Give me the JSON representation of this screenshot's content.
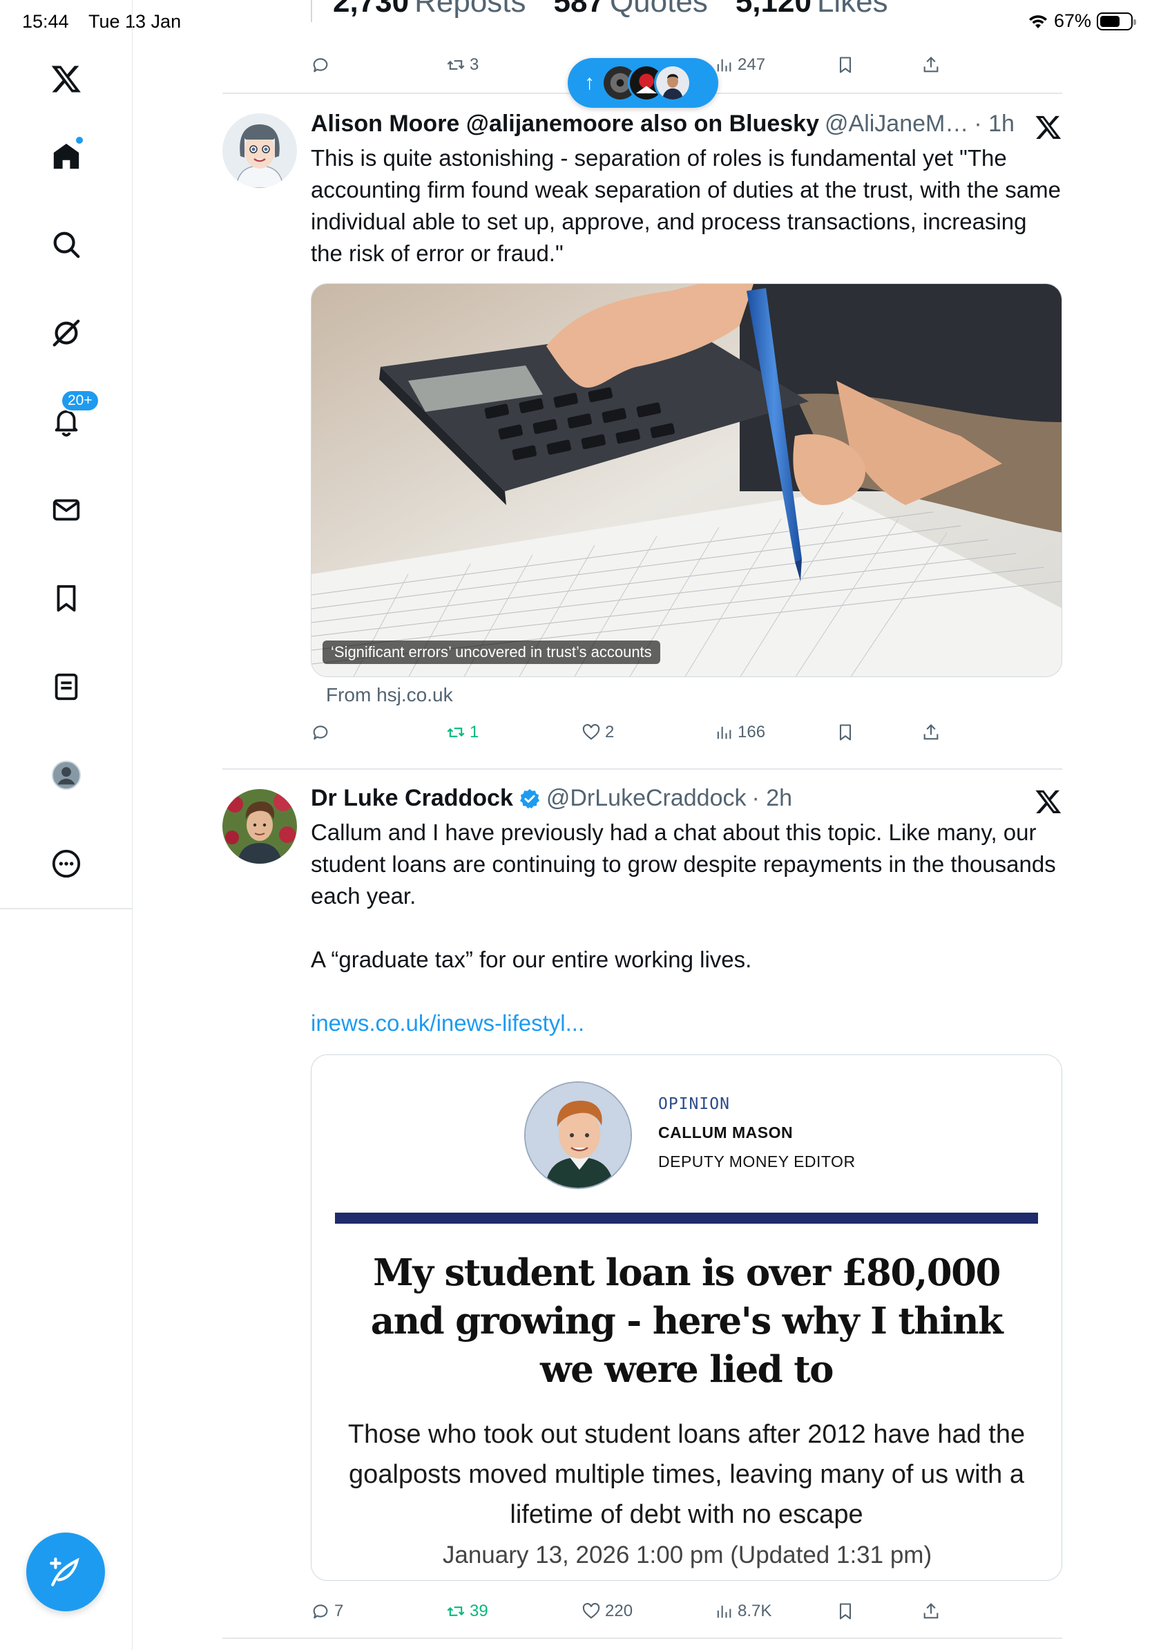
{
  "status_bar": {
    "time": "15:44",
    "date": "Tue 13 Jan",
    "battery": "67%",
    "battery_level": 0.67
  },
  "sidebar": {
    "items": [
      {
        "name": "x-logo",
        "icon": "x-logo-icon"
      },
      {
        "name": "home",
        "icon": "home-icon",
        "unread_dot": true
      },
      {
        "name": "explore",
        "icon": "search-icon"
      },
      {
        "name": "grok",
        "icon": "grok-icon"
      },
      {
        "name": "notifications",
        "icon": "bell-icon",
        "badge": "20+"
      },
      {
        "name": "messages",
        "icon": "envelope-icon"
      },
      {
        "name": "bookmarks",
        "icon": "bookmark-icon"
      },
      {
        "name": "lists",
        "icon": "list-icon"
      },
      {
        "name": "profile",
        "icon": "avatar-icon"
      },
      {
        "name": "more",
        "icon": "more-icon"
      }
    ],
    "compose": {
      "icon": "compose-icon"
    }
  },
  "top_tweet": {
    "stats": {
      "reposts_value": "2,730",
      "reposts_label": "Reposts",
      "quotes_value": "587",
      "quotes_label": "Quotes",
      "likes_value": "5,120",
      "likes_label": "Likes"
    },
    "actions": {
      "reposts": "3",
      "views": "247"
    }
  },
  "new_posts_pill": {
    "arrow": "↑"
  },
  "tweets": [
    {
      "name": "Alison Moore @alijanemoore also on Bluesky",
      "handle": "@AliJaneM…",
      "time": "· 1h",
      "text": "This is quite astonishing - separation of roles is fundamental yet \"The accounting firm found weak separation of duties at the trust, with the same individual able to set up, approve, and process transactions, increasing the risk of error or fraud.\"",
      "media_caption": "‘Significant errors’ uncovered in trust’s accounts",
      "from": "From hsj.co.uk",
      "actions": {
        "replies": "",
        "reposts": "1",
        "likes": "2",
        "views": "166"
      }
    },
    {
      "name": "Dr Luke Craddock",
      "handle": "@DrLukeCraddock",
      "time": "· 2h",
      "text": "Callum and I have previously had a chat about this topic. Like many, our student loans are continuing to grow despite repayments in the thousands each year.\n\nA “graduate tax” for our entire working lives.",
      "link": "inews.co.uk/inews-lifestyl...",
      "article": {
        "kicker": "OPINION",
        "author": "CALLUM MASON",
        "role": "DEPUTY MONEY EDITOR",
        "headline": "My student loan is over £80,000 and growing - here's why I think we were lied to",
        "standfirst": "Those who took out student loans after 2012 have had the goalposts moved multiple times, leaving many of us with a lifetime of debt with no escape",
        "date": "January 13, 2026 1:00 pm (Updated 1:31 pm)"
      },
      "actions": {
        "replies": "7",
        "reposts": "39",
        "likes": "220",
        "views": "8.7K"
      }
    }
  ],
  "colors": {
    "accent": "#1d9bf0",
    "repost": "#00ba7c",
    "secondary_text": "#536471"
  }
}
